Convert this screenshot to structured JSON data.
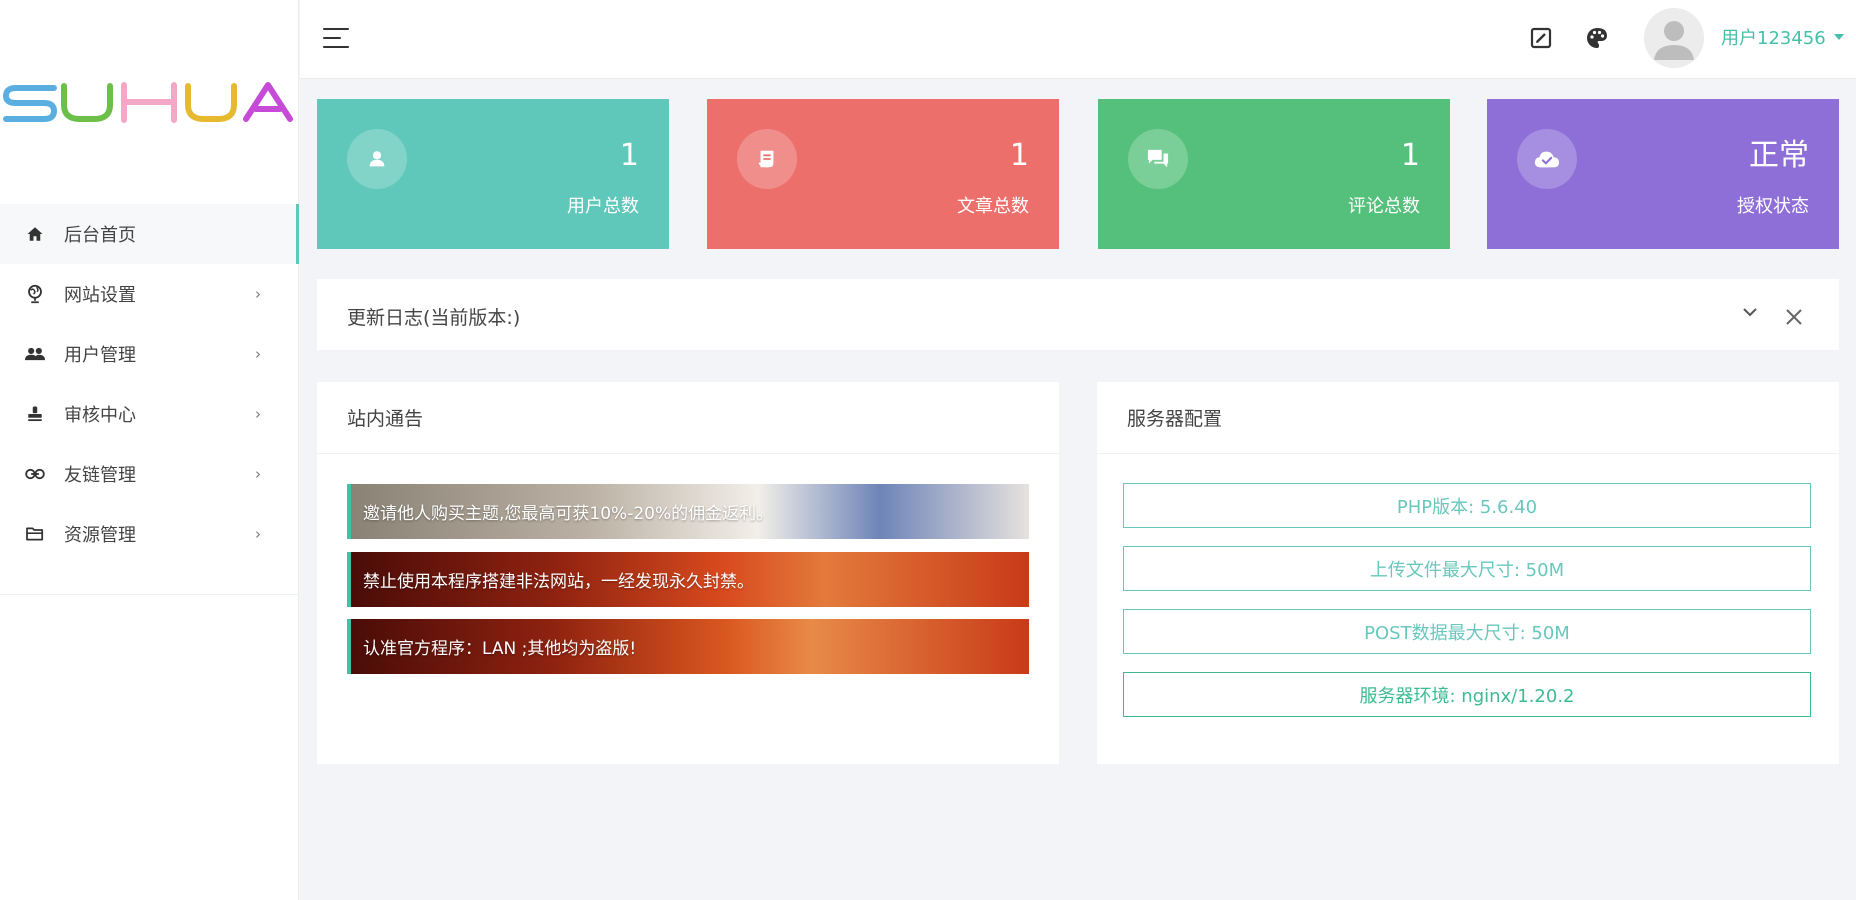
{
  "brand": {
    "logo_text": "SUHUA",
    "letter_colors": [
      "#5aaee0",
      "#6cc04a",
      "#f4a7c6",
      "#e6b92f",
      "#c64bd6"
    ]
  },
  "sidebar": {
    "items": [
      {
        "label": "后台首页",
        "icon": "home-icon",
        "active": true,
        "has_arrow": false
      },
      {
        "label": "网站设置",
        "icon": "globe-icon",
        "active": false,
        "has_arrow": true
      },
      {
        "label": "用户管理",
        "icon": "users-icon",
        "active": false,
        "has_arrow": true
      },
      {
        "label": "审核中心",
        "icon": "stamp-icon",
        "active": false,
        "has_arrow": true
      },
      {
        "label": "友链管理",
        "icon": "link-icon",
        "active": false,
        "has_arrow": true
      },
      {
        "label": "资源管理",
        "icon": "folder-icon",
        "active": false,
        "has_arrow": true
      }
    ],
    "arrow_glyph": "›"
  },
  "header": {
    "menu_icon": "hamburger-icon",
    "icons": [
      "edit-icon",
      "palette-icon"
    ],
    "username": "用户123456"
  },
  "stats": [
    {
      "value": "1",
      "label": "用户总数",
      "icon": "user-icon",
      "color": "#5fc8ba"
    },
    {
      "value": "1",
      "label": "文章总数",
      "icon": "article-icon",
      "color": "#ec6f6c"
    },
    {
      "value": "1",
      "label": "评论总数",
      "icon": "comment-icon",
      "color": "#55c07b"
    },
    {
      "value": "正常",
      "label": "授权状态",
      "icon": "cloud-check-icon",
      "color": "#8e6fd8"
    }
  ],
  "changelog": {
    "title": "更新日志(当前版本:)"
  },
  "notices_panel": {
    "title": "站内通告",
    "items": [
      "邀请他人购买主题,您最高可获10%-20%的佣金返利。",
      "禁止使用本程序搭建非法网站，一经发现永久封禁。",
      "认准官方程序：LAN ;其他均为盗版!"
    ]
  },
  "server_panel": {
    "title": "服务器配置",
    "items": [
      "PHP版本: 5.6.40",
      "上传文件最大尺寸: 50M",
      "POST数据最大尺寸: 50M",
      "服务器环境: nginx/1.20.2"
    ]
  },
  "colors": {
    "accent": "#45bfa9",
    "server_border": "#69c7bd",
    "server_last": "#3dbb8f"
  }
}
